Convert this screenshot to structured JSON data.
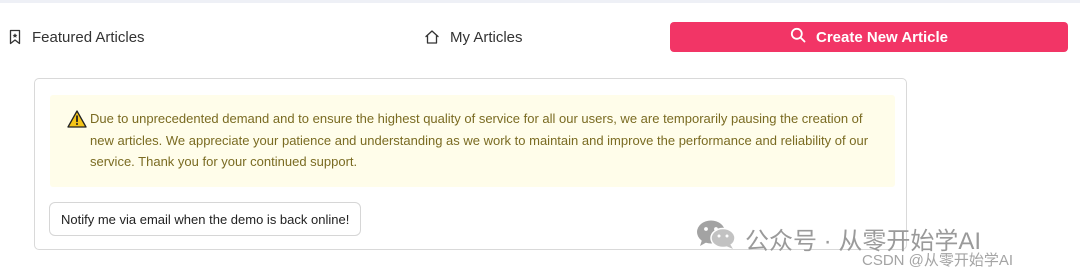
{
  "nav": {
    "featured_label": "Featured Articles",
    "my_label": "My Articles",
    "create_label": "Create New Article"
  },
  "notice": {
    "text": "Due to unprecedented demand and to ensure the highest quality of service for all our users, we are temporarily pausing the creation of new articles. We appreciate your patience and understanding as we work to maintain and improve the performance and reliability of our service. Thank you for your continued support."
  },
  "notify_label": "Notify me via email when the demo is back online!",
  "watermark": {
    "wechat": "公众号 · 从零开始学AI",
    "csdn": "CSDN @从零开始学AI"
  },
  "icons": {
    "featured": "bookmark-icon",
    "my": "home-icon",
    "create": "search-icon",
    "warning": "warning-icon",
    "wechat": "wechat-icon"
  },
  "colors": {
    "accent": "#f23566",
    "notice_bg": "#fffdea",
    "notice_text": "#7a6b22"
  }
}
